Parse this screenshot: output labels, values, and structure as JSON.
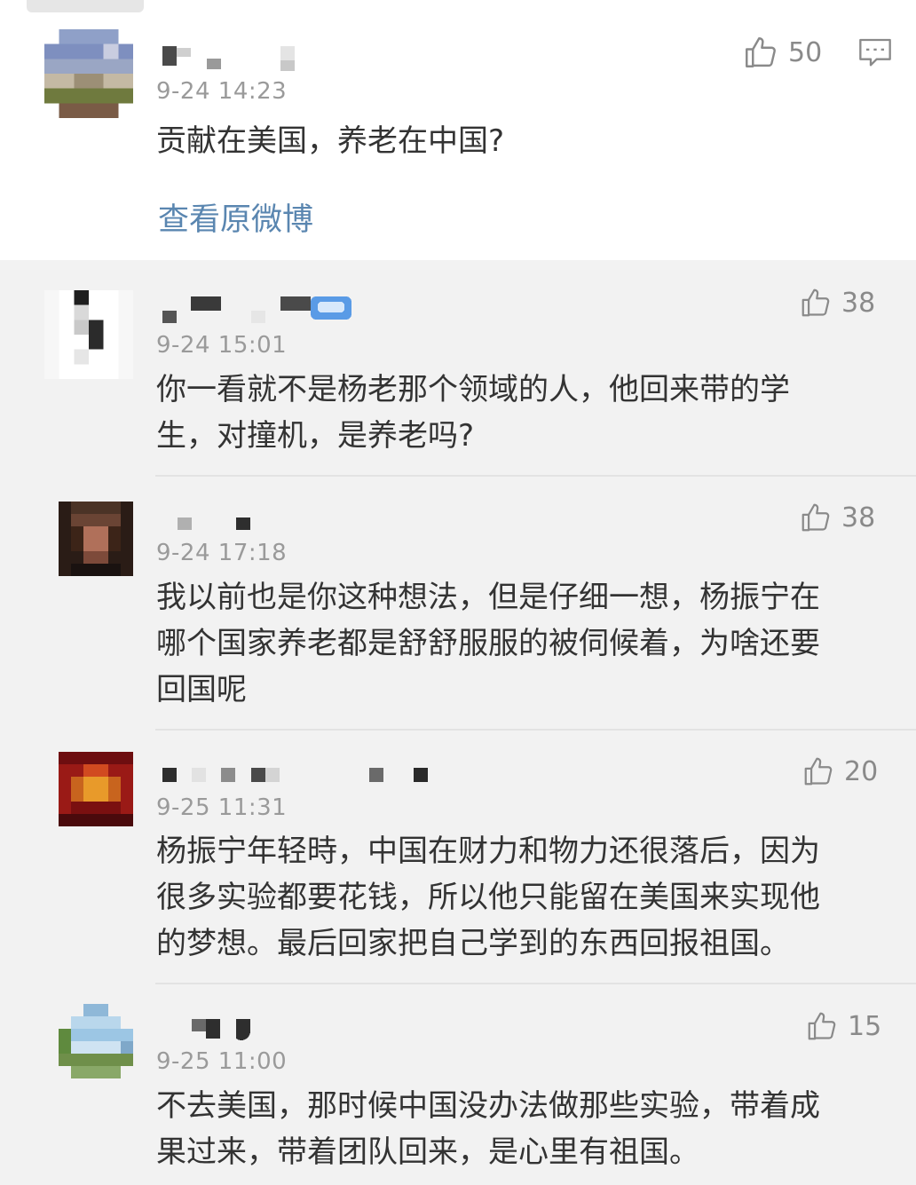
{
  "main_comment": {
    "timestamp": "9-24 14:23",
    "text": "贡献在美国，养老在中国?",
    "likes": "50",
    "view_original_label": "查看原微博",
    "icons": {
      "like": "thumbs-up-icon",
      "reply": "comment-icon"
    }
  },
  "replies": [
    {
      "timestamp": "9-24 15:01",
      "likes": "38",
      "lines": [
        "你一看就不是杨老那个领域的人，他回来带的学",
        "生，对撞机，是养老吗?"
      ]
    },
    {
      "timestamp": "9-24 17:18",
      "likes": "38",
      "lines": [
        "我以前也是你这种想法，但是仔细一想，杨振宁在",
        "哪个国家养老都是舒舒服服的被伺候着，为啥还要",
        "回国呢"
      ]
    },
    {
      "timestamp": "9-25 11:31",
      "likes": "20",
      "lines": [
        "杨振宁年轻時，中国在财力和物力还很落后，因为",
        "很多实验都要花钱，所以他只能留在美国来实现他",
        "的梦想。最后回家把自己学到的东西回报祖国。"
      ]
    },
    {
      "timestamp": "9-25 11:00",
      "likes": "15",
      "lines": [
        "不去美国，那时候中国没办法做那些实验，带着成",
        "果过来，带着团队回来，是心里有祖国。"
      ]
    }
  ],
  "colors": {
    "text": "#333333",
    "timestamp": "#9a9a9a",
    "link": "#5a86b0",
    "like": "#8a8a8a",
    "reply_background": "#f2f2f2"
  }
}
